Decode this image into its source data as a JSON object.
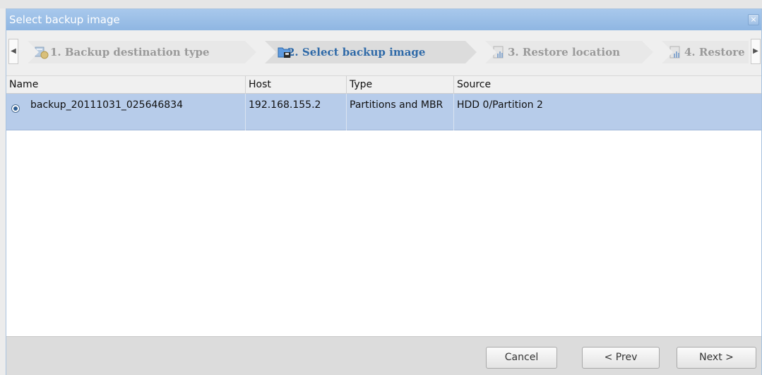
{
  "dialog": {
    "title": "Select backup image",
    "close_glyph": "×"
  },
  "wizard": {
    "steps": [
      {
        "label": "1. Backup destination type",
        "state": "inactive"
      },
      {
        "label": "2. Select backup image",
        "state": "active"
      },
      {
        "label": "3. Restore location",
        "state": "inactive"
      },
      {
        "label": "4. Restore",
        "state": "inactive"
      }
    ],
    "scroll_left_glyph": "◀",
    "scroll_right_glyph": "▶"
  },
  "grid": {
    "columns": [
      "Name",
      "Host",
      "Type",
      "Source"
    ],
    "rows": [
      {
        "name": "backup_20111031_025646834",
        "host": "192.168.155.2",
        "type": "Partitions and MBR",
        "source": "HDD 0/Partition 2",
        "selected": true
      }
    ],
    "selected_row_color": "#b7ccea"
  },
  "footer": {
    "cancel": "Cancel",
    "prev": "< Prev",
    "next": "Next >"
  },
  "colors": {
    "accent": "#2f6aa8",
    "titlebar": "#9dbfe8"
  }
}
